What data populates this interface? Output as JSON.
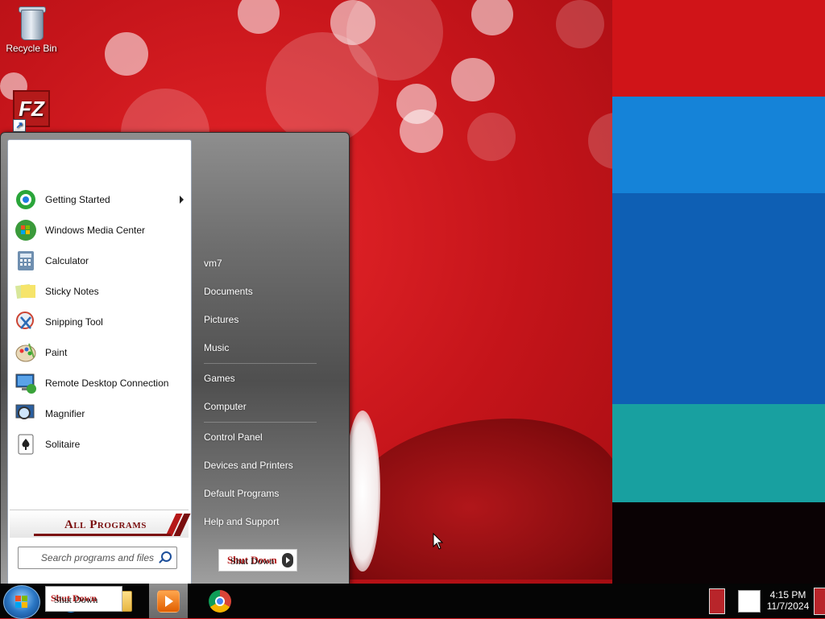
{
  "desktop": {
    "icons": [
      {
        "label": "Recycle Bin",
        "icon": "recycle-bin-icon"
      },
      {
        "label": "",
        "icon": "filezilla-icon",
        "glyph": "FZ"
      }
    ],
    "colors": {
      "wallpaper_red": "#c4141a",
      "stripe_red": "#d01418",
      "stripe_blue_light": "#1583d8",
      "stripe_blue_dark": "#0e5fb4",
      "stripe_teal": "#18a0a0",
      "stripe_black": "#0a0204"
    }
  },
  "start_menu": {
    "programs": [
      {
        "label": "Getting Started",
        "icon": "getting-started-icon",
        "has_submenu": true
      },
      {
        "label": "Windows Media Center",
        "icon": "windows-media-center-icon"
      },
      {
        "label": "Calculator",
        "icon": "calculator-icon"
      },
      {
        "label": "Sticky Notes",
        "icon": "sticky-notes-icon"
      },
      {
        "label": "Snipping Tool",
        "icon": "snipping-tool-icon"
      },
      {
        "label": "Paint",
        "icon": "paint-icon"
      },
      {
        "label": "Remote Desktop Connection",
        "icon": "remote-desktop-icon"
      },
      {
        "label": "Magnifier",
        "icon": "magnifier-icon"
      },
      {
        "label": "Solitaire",
        "icon": "solitaire-icon"
      }
    ],
    "all_programs_label": "All Programs",
    "search_placeholder": "Search programs and files",
    "right_items": [
      {
        "label": "vm7"
      },
      {
        "label": "Documents"
      },
      {
        "label": "Pictures"
      },
      {
        "label": "Music"
      },
      {
        "label": "Games"
      },
      {
        "label": "Computer"
      },
      {
        "label": "Control Panel"
      },
      {
        "label": "Devices and Printers"
      },
      {
        "label": "Default Programs"
      },
      {
        "label": "Help and Support"
      }
    ],
    "shutdown_label": "Shut Down",
    "shutdown_label_overlay": "Shut Down"
  },
  "taskbar": {
    "start_icon": "windows-start-orb-icon",
    "shutdown_overlay_label": "Shut Down",
    "shutdown_overlay_label2": "Shut Down",
    "pinned": [
      {
        "name": "internet-explorer-icon",
        "glyph": "e"
      },
      {
        "name": "windows-explorer-icon"
      },
      {
        "name": "windows-media-player-icon"
      },
      {
        "name": "chrome-icon"
      }
    ],
    "clock": {
      "time": "4:15 PM",
      "date": "11/7/2024"
    }
  }
}
